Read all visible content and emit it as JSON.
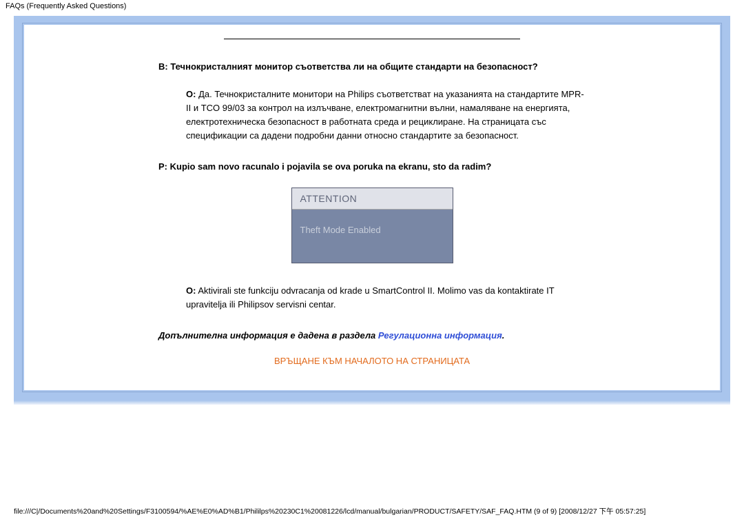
{
  "header": {
    "title": "FAQs (Frequently Asked Questions)"
  },
  "q1": {
    "prefix": "В:",
    "text": "Течнокристалният монитор съответства ли на общите стандарти на безопасност?"
  },
  "a1": {
    "prefix": "О:",
    "text": " Да. Течнокристалните монитори на Philips съответстват на указанията на стандартите MPR-II и TCO 99/03 за контрол на излъчване, електромагнитни вълни, намаляване на енергията, електротехническа безопасност в работната среда и рециклиране. На страницата със спецификации са дадени подробни данни относно стандартите за безопасност."
  },
  "q2": {
    "prefix": "P:",
    "text": "Kupio sam novo racunalo i pojavila se ova poruka na ekranu, sto da radim?"
  },
  "attention": {
    "header": "ATTENTION",
    "body": "Theft Mode Enabled"
  },
  "a2": {
    "prefix": "O:",
    "text": " Aktivirali ste funkciju odvracanja od krade u SmartControl II. Molimo vas da kontaktirate IT upravitelja ili Philipsov servisni centar."
  },
  "extra": {
    "text": "Допълнителна информация е дадена в раздела ",
    "link": "Регулационна информация",
    "suffix": "."
  },
  "back_link": "ВРЪЩАНЕ КЪМ НАЧАЛОТО НА СТРАНИЦАТА",
  "footer": {
    "path": "file:///C|/Documents%20and%20Settings/F3100594/%AE%E0%AD%B1/Phililps%20230C1%20081226/lcd/manual/bulgarian/PRODUCT/SAFETY/SAF_FAQ.HTM (9 of 9) [2008/12/27 下午 05:57:25]"
  }
}
